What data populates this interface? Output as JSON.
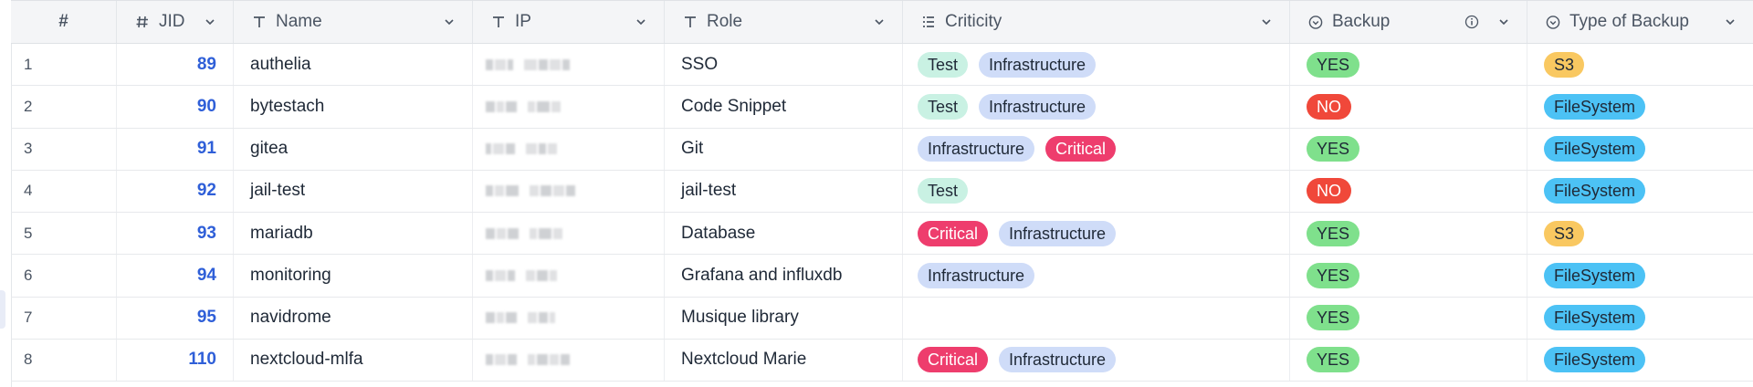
{
  "columns": [
    {
      "key": "idx",
      "label": "#",
      "icon": "none"
    },
    {
      "key": "jid",
      "label": "JID",
      "icon": "hash-icon"
    },
    {
      "key": "name",
      "label": "Name",
      "icon": "text-type-icon"
    },
    {
      "key": "ip",
      "label": "IP",
      "icon": "text-type-icon"
    },
    {
      "key": "role",
      "label": "Role",
      "icon": "text-type-icon"
    },
    {
      "key": "criticity",
      "label": "Criticity",
      "icon": "list-icon"
    },
    {
      "key": "backup",
      "label": "Backup",
      "icon": "check-circle-icon"
    },
    {
      "key": "type",
      "label": "Type of Backup",
      "icon": "check-circle-icon"
    }
  ],
  "rows": [
    {
      "idx": "1",
      "jid": "89",
      "name": "authelia",
      "role": "SSO",
      "criticity": [
        "Test",
        "Infrastructure"
      ],
      "backup": "YES",
      "type": "S3"
    },
    {
      "idx": "2",
      "jid": "90",
      "name": "bytestach",
      "role": "Code Snippet",
      "criticity": [
        "Test",
        "Infrastructure"
      ],
      "backup": "NO",
      "type": "FileSystem"
    },
    {
      "idx": "3",
      "jid": "91",
      "name": "gitea",
      "role": "Git",
      "criticity": [
        "Infrastructure",
        "Critical"
      ],
      "backup": "YES",
      "type": "FileSystem"
    },
    {
      "idx": "4",
      "jid": "92",
      "name": "jail-test",
      "role": "jail-test",
      "criticity": [
        "Test"
      ],
      "backup": "NO",
      "type": "FileSystem"
    },
    {
      "idx": "5",
      "jid": "93",
      "name": "mariadb",
      "role": "Database",
      "criticity": [
        "Critical",
        "Infrastructure"
      ],
      "backup": "YES",
      "type": "S3"
    },
    {
      "idx": "6",
      "jid": "94",
      "name": "monitoring",
      "role": "Grafana and influxdb",
      "criticity": [
        "Infrastructure"
      ],
      "backup": "YES",
      "type": "FileSystem"
    },
    {
      "idx": "7",
      "jid": "95",
      "name": "navidrome",
      "role": "Musique library",
      "criticity": [],
      "backup": "YES",
      "type": "FileSystem"
    },
    {
      "idx": "8",
      "jid": "110",
      "name": "nextcloud-mlfa",
      "role": "Nextcloud Marie",
      "criticity": [
        "Critical",
        "Infrastructure"
      ],
      "backup": "YES",
      "type": "FileSystem"
    }
  ],
  "colors": {
    "test": "#c9f1e3",
    "infrastructure": "#cfdcf8",
    "critical": "#ee3d6d",
    "yes": "#7fe08c",
    "no": "#f0483a",
    "s3": "#f9c861",
    "filesystem": "#4cc2f5",
    "jid_text": "#2f5fd8"
  }
}
